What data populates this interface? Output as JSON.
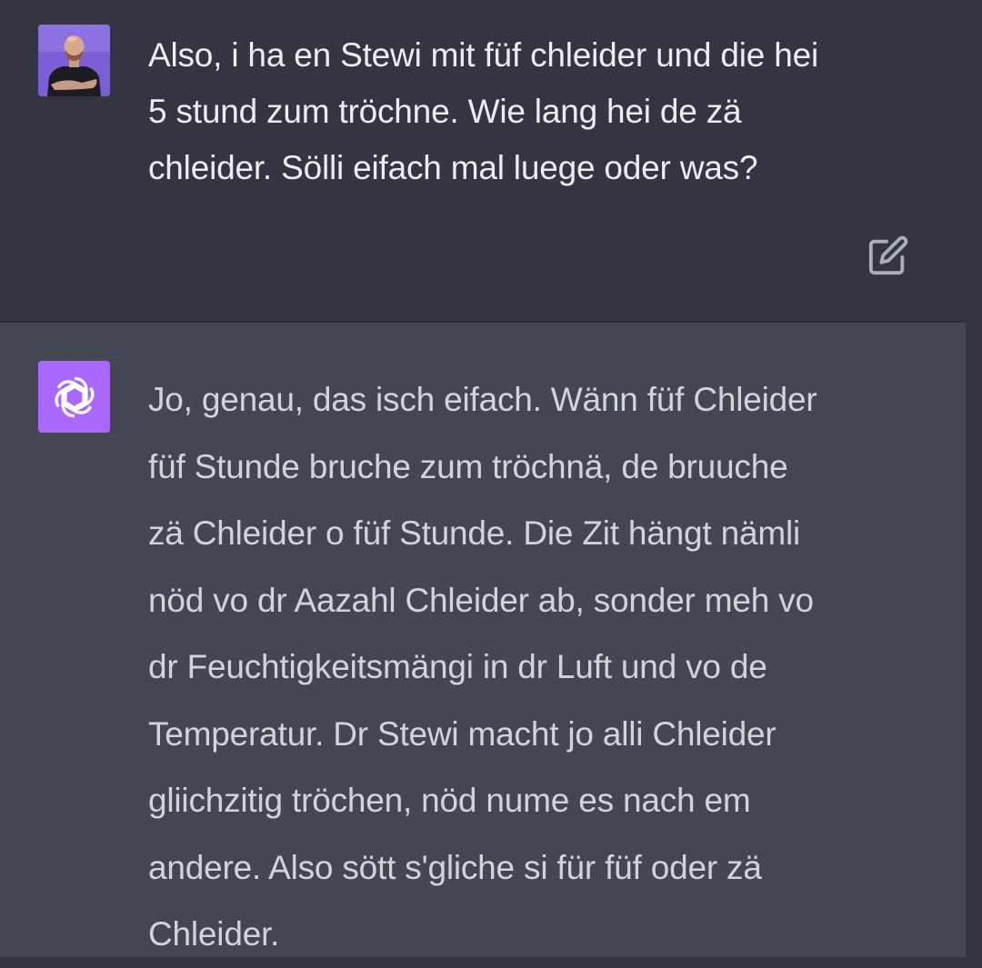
{
  "user_message": {
    "lines": [
      "Also, i ha en Stewi mit füf chleider und die hei",
      "5 stund zum tröchne. Wie lang hei de zä",
      "chleider. Sölli eifach mal luege oder was?"
    ],
    "avatar_icon": "user-avatar-photo",
    "edit_icon": "edit-icon"
  },
  "assistant_message": {
    "lines": [
      "Jo, genau, das isch eifach. Wänn füf Chleider",
      "füf Stunde bruche zum tröchnä, de bruuche",
      "zä Chleider o füf Stunde. Die Zit hängt nämli",
      "nöd vo dr Aazahl Chleider ab, sonder meh vo",
      "dr Feuchtigkeitsmängi in dr Luft und vo de",
      "Temperatur. Dr Stewi macht jo alli Chleider",
      "gliichzitig tröchen, nöd nume es nach em",
      "andere. Also sött s'gliche si für füf oder zä",
      "Chleider."
    ],
    "avatar_icon": "openai-logo-icon"
  },
  "colors": {
    "user_bg": "#343541",
    "assistant_bg": "#444654",
    "user_text": "#ececf1",
    "assistant_text": "#d1d5db",
    "assistant_avatar_bg": "#ab68ff",
    "icon_gray": "#acacbe"
  }
}
